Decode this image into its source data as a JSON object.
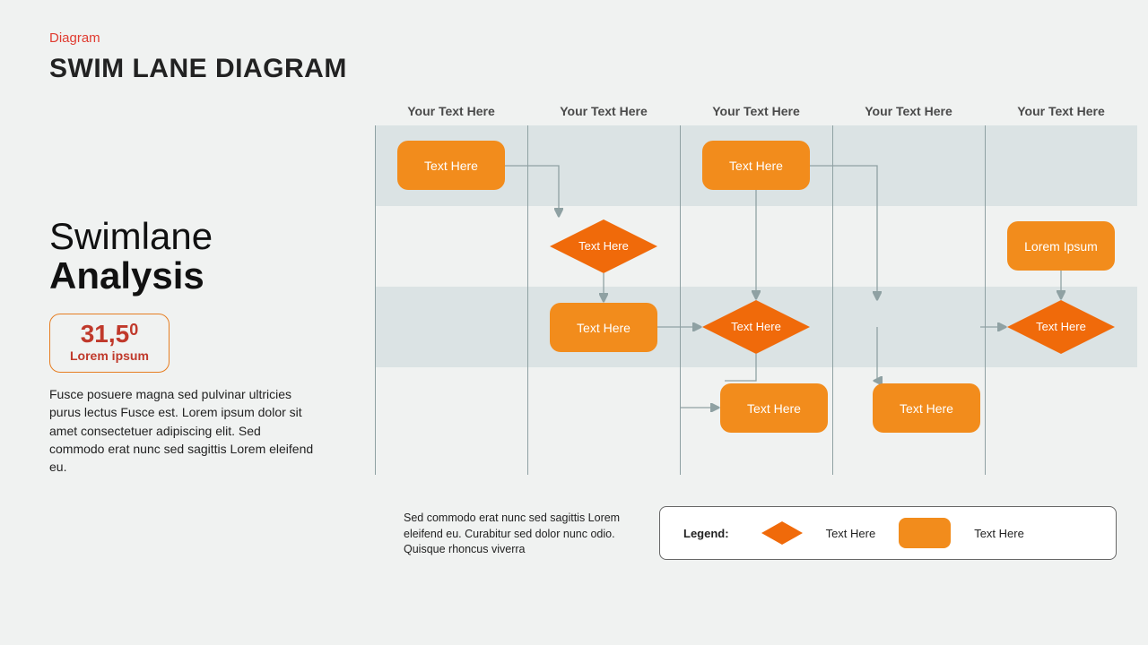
{
  "eyebrow": "Diagram",
  "title": "SWIM LANE DIAGRAM",
  "lanes": [
    "Your Text Here",
    "Your Text Here",
    "Your Text Here",
    "Your Text Here",
    "Your Text Here"
  ],
  "subtitle_line1": "Swimlane",
  "subtitle_line2": "Analysis",
  "metric_value": "31,5",
  "metric_super": "0",
  "metric_label": "Lorem ipsum",
  "body": "Fusce posuere magna sed pulvinar ultricies purus lectus Fusce est. Lorem ipsum dolor sit amet consectetuer adipiscing elit. Sed commodo erat nunc sed sagittis Lorem eleifend eu.",
  "foot_note": "Sed commodo erat nunc sed sagittis Lorem eleifend eu. Curabitur sed dolor nunc odio. Quisque rhoncus viverra",
  "legend_label": "Legend:",
  "legend_dmd": "Text Here",
  "legend_rect": "Text Here",
  "shapes": {
    "rectA": "Text Here",
    "diaB": "Text Here",
    "rectC": "Text Here",
    "rectD": "Text Here",
    "diaE": "Text Here",
    "rectF": "Text Here",
    "rectG": "Text Here",
    "rectH": "Lorem Ipsum",
    "diaI": "Text Here"
  }
}
